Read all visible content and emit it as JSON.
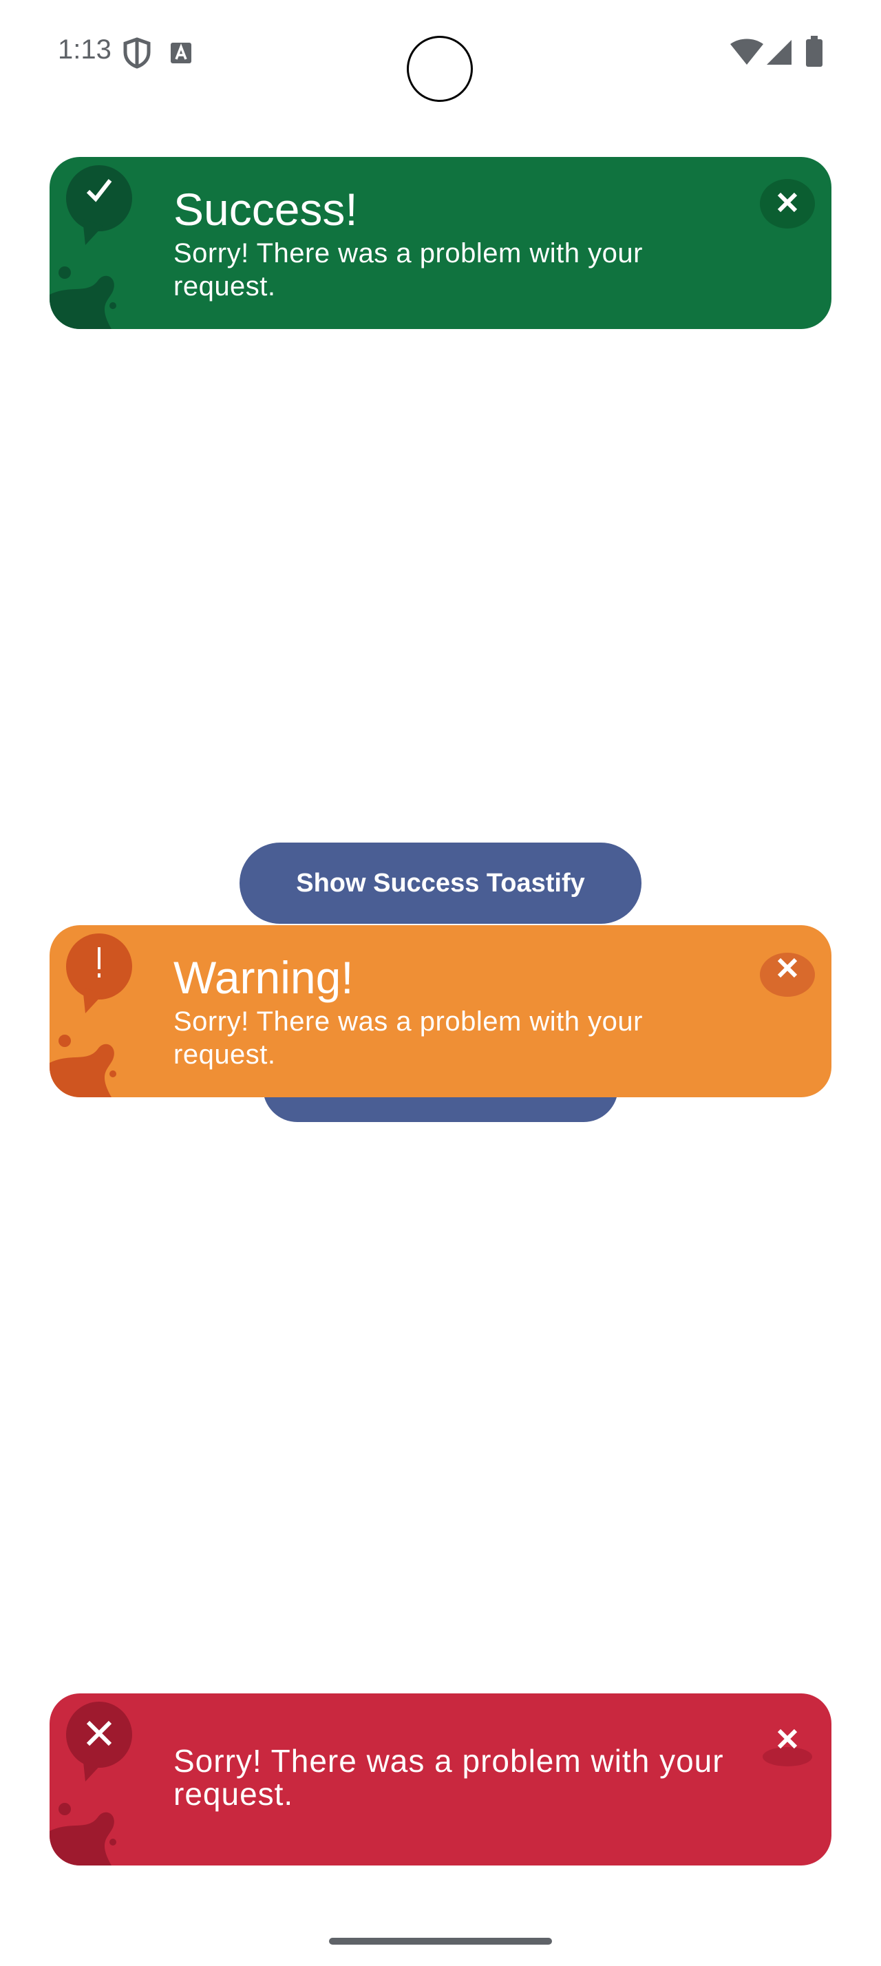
{
  "status_bar": {
    "time": "1:13",
    "icons": [
      "shield-icon",
      "font-icon",
      "wifi-icon",
      "signal-icon",
      "battery-icon"
    ]
  },
  "toasts": {
    "success": {
      "title": "Success!",
      "message": "Sorry! There was a problem with your request.",
      "color": "#10733f",
      "icon": "checkmark-icon"
    },
    "warning": {
      "title": "Warning!",
      "message": "Sorry! There was a problem with your request.",
      "color": "#ef8f35",
      "icon": "exclamation-icon"
    },
    "error": {
      "title": "",
      "message": "Sorry! There was a problem with your request.",
      "color": "#c9283f",
      "icon": "x-icon"
    }
  },
  "buttons": {
    "show_success": "Show Success Toastify"
  },
  "colors": {
    "button": "#4a5e94"
  }
}
